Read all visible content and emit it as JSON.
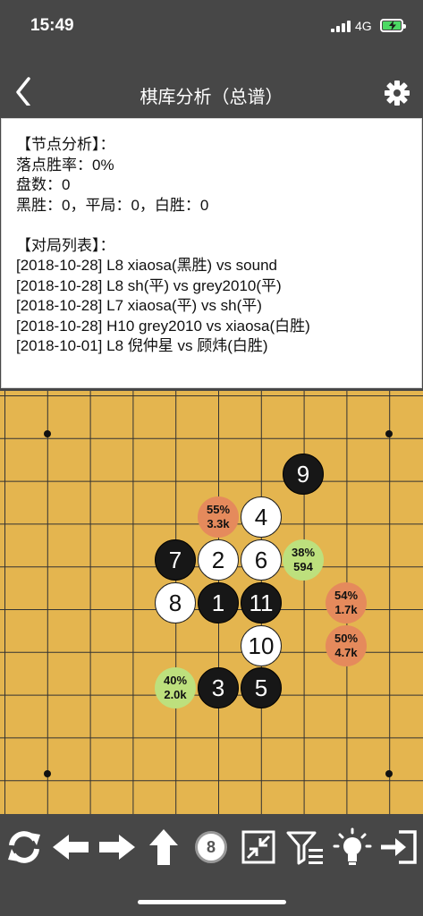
{
  "status_bar": {
    "time": "15:49",
    "network": "4G"
  },
  "nav": {
    "title": "棋库分析（总谱）"
  },
  "node_analysis": {
    "heading": "【节点分析】：",
    "win_rate": "落点胜率：0%",
    "games": "盘数：0",
    "results": "黑胜：0，平局：0，白胜：0"
  },
  "game_list": {
    "heading": "【对局列表】：",
    "items": [
      "[2018-10-28] L8 xiaosa(黑胜) vs sound",
      "[2018-10-28] L8 sh(平) vs grey2010(平)",
      "[2018-10-28] L7 xiaosa(平) vs sh(平)",
      "[2018-10-28] H10 grey2010 vs xiaosa(白胜)",
      "[2018-10-01] L8 倪仲星 vs 顾炜(白胜)"
    ]
  },
  "stones": [
    {
      "label": "1",
      "color": "black"
    },
    {
      "label": "2",
      "color": "white"
    },
    {
      "label": "3",
      "color": "black"
    },
    {
      "label": "4",
      "color": "white"
    },
    {
      "label": "5",
      "color": "black"
    },
    {
      "label": "6",
      "color": "white"
    },
    {
      "label": "7",
      "color": "black"
    },
    {
      "label": "8",
      "color": "white"
    },
    {
      "label": "9",
      "color": "black"
    },
    {
      "label": "10",
      "color": "white"
    },
    {
      "label": "11",
      "color": "black"
    }
  ],
  "candidates": [
    {
      "rate": "55%",
      "count": "3.3k",
      "color": "#e58a5c"
    },
    {
      "rate": "38%",
      "count": "594",
      "color": "#bde07d"
    },
    {
      "rate": "54%",
      "count": "1.7k",
      "color": "#e58a5c"
    },
    {
      "rate": "50%",
      "count": "4.7k",
      "color": "#e58a5c"
    },
    {
      "rate": "40%",
      "count": "2.0k",
      "color": "#bde07d"
    }
  ],
  "toolbar": {
    "move_number": "8",
    "icons": [
      "refresh-icon",
      "arrow-left-icon",
      "arrow-right-icon",
      "arrow-up-icon",
      "move-number-badge",
      "collapse-icon",
      "filter-list-icon",
      "lightbulb-icon",
      "exit-icon"
    ]
  },
  "colors": {
    "board": "#e4b54f",
    "bar": "#474747",
    "black_stone": "#171717",
    "white_stone": "#ffffff"
  }
}
